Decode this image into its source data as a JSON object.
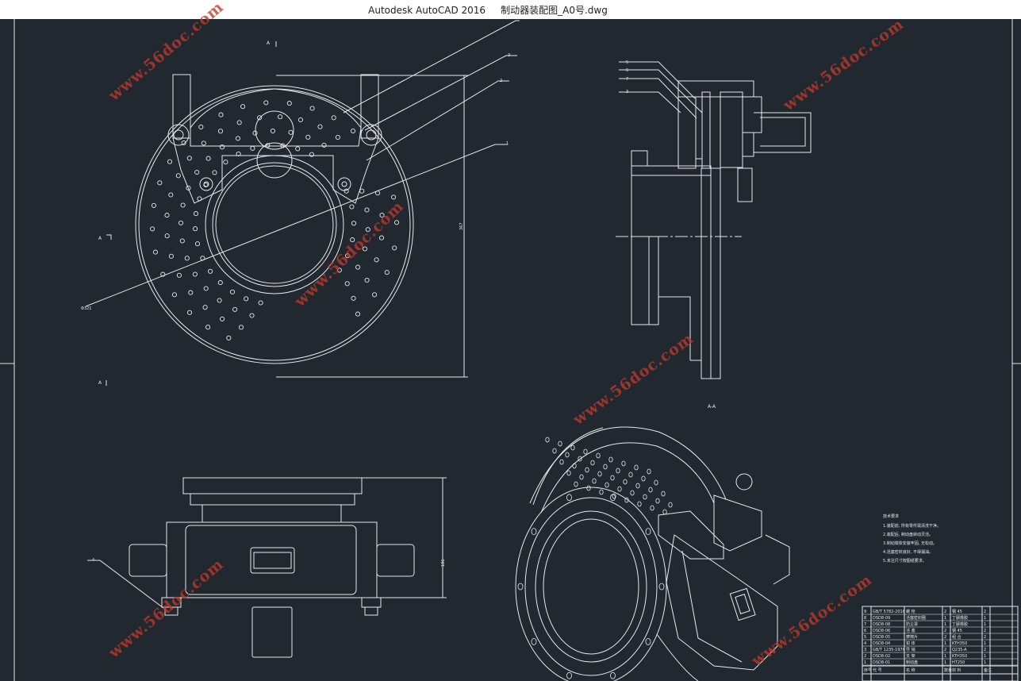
{
  "window": {
    "title": "Autodesk AutoCAD 2016     制动器装配图_A0号.dwg"
  },
  "colors": {
    "canvas_bg": "#212830",
    "line": "#e8e8e8",
    "watermark": "#c0392b"
  },
  "watermark": {
    "text": "www.56doc.com"
  },
  "drawing": {
    "section_marks": [
      "A",
      "A",
      "A"
    ],
    "section_label": "A-A",
    "part_callouts_front": [
      "3",
      "2",
      "1"
    ],
    "part_callouts_side": [
      "5",
      "6",
      "7",
      "3"
    ],
    "part_callout_bottom": "4",
    "dim_height": "367",
    "dim_bottom": "186",
    "dim_dia": "Φ321"
  },
  "tech_notes": [
    "技术要求",
    "1.装配前, 所有零件需清洗干净。",
    "2.装配后, 制动盘转动灵活。",
    "3.制动钳体安装牢固, 无松动。",
    "4.活塞密封良好, 不得漏油。",
    "5.未注尺寸按图纸要求。"
  ],
  "bom": {
    "rows": [
      {
        "no": "9",
        "code": "GB/T 5782-2016",
        "name": "螺 栓",
        "qty": "2",
        "material": "钢 45",
        "q2": "2"
      },
      {
        "no": "8",
        "code": "DSD8-09",
        "name": "活塞密封圈",
        "qty": "1",
        "material": "丁腈橡胶",
        "q2": "1"
      },
      {
        "no": "7",
        "code": "DSD8-08",
        "name": "防尘罩",
        "qty": "1",
        "material": "丁腈橡胶",
        "q2": "1"
      },
      {
        "no": "6",
        "code": "DSD8-06",
        "name": "活 塞",
        "qty": "2",
        "material": "钢 45",
        "q2": "2"
      },
      {
        "no": "5",
        "code": "DSD8-05",
        "name": "摩擦片",
        "qty": "2",
        "material": "组 合",
        "q2": "2"
      },
      {
        "no": "4",
        "code": "DSD8-04",
        "name": "钳 体",
        "qty": "1",
        "material": "KTH350",
        "q2": "1"
      },
      {
        "no": "3",
        "code": "GB/T 1235-1976",
        "name": "导 销",
        "qty": "2",
        "material": "Q235-A",
        "q2": "2"
      },
      {
        "no": "2",
        "code": "DSD8-02",
        "name": "支 架",
        "qty": "1",
        "material": "KTH350",
        "q2": "1"
      },
      {
        "no": "1",
        "code": "DSD8-01",
        "name": "制动盘",
        "qty": "1",
        "material": "HT250",
        "q2": "1"
      }
    ],
    "header": [
      "序号",
      "代 号",
      "名 称",
      "数量",
      "材 料",
      "备注"
    ]
  }
}
